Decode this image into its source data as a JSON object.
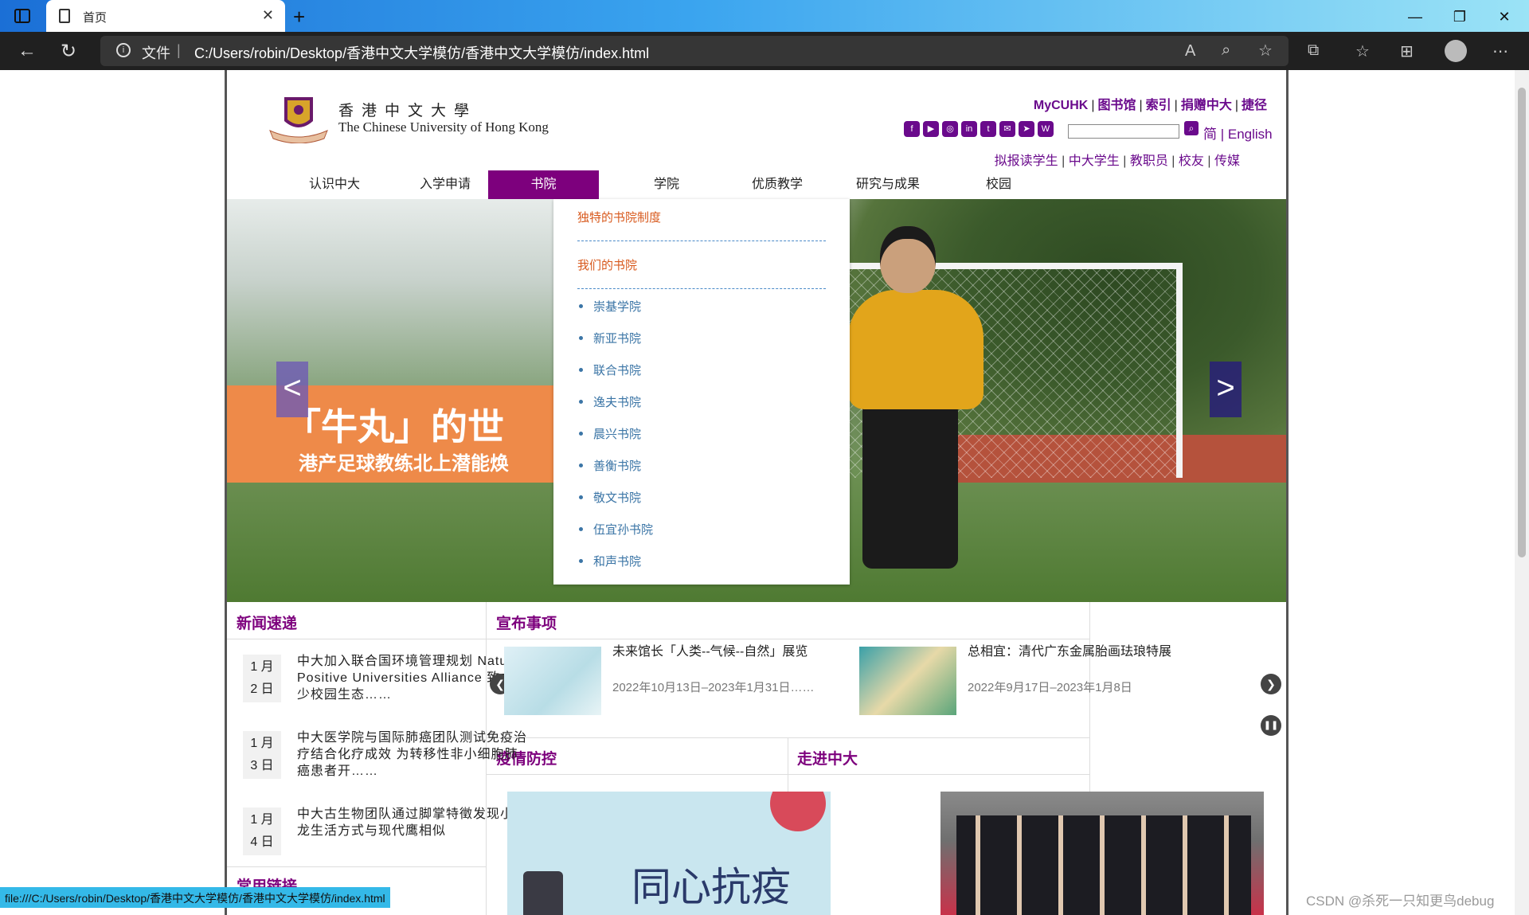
{
  "browser": {
    "tab_title": "首页",
    "url_scheme": "文件",
    "url": "C:/Users/robin/Desktop/香港中文大学模仿/香港中文大学模仿/index.html",
    "status_url": "file:///C:/Users/robin/Desktop/香港中文大学模仿/香港中文大学模仿/index.html"
  },
  "header": {
    "logo_cn": "香港中文大學",
    "logo_en": "The Chinese University of Hong Kong",
    "top_links": [
      "MyCUHK",
      "图书馆",
      "索引",
      "捐赠中大",
      "捷径"
    ],
    "lang_simplified": "简",
    "lang_english": "English",
    "audience_links": [
      "拟报读学生",
      "中大学生",
      "教职员",
      "校友",
      "传媒"
    ]
  },
  "nav": {
    "items": [
      "认识中大",
      "入学申请",
      "书院",
      "学院",
      "优质教学",
      "研究与成果",
      "校园"
    ],
    "active": "书院"
  },
  "dropdown": {
    "heading1": "独特的书院制度",
    "heading2": "我们的书院",
    "colleges": [
      "崇基学院",
      "新亚书院",
      "联合书院",
      "逸夫书院",
      "晨兴书院",
      "善衡书院",
      "敬文书院",
      "伍宜孙书院",
      "和声书院"
    ]
  },
  "hero": {
    "title": "「牛丸」的世",
    "subtitle": "港产足球教练北上潜能焕",
    "prev": "<",
    "next": ">"
  },
  "sections": {
    "news_title": "新闻速递",
    "announce_title": "宣布事项",
    "epidemic_title": "疫情防控",
    "explore_title": "走进中大",
    "links_title": "常用链接"
  },
  "news": [
    {
      "month": "1 月",
      "day": "2 日",
      "text": "中大加入联合国环境管理规划 Nature Positive Universities Alliance 致力减少校园生态……"
    },
    {
      "month": "1 月",
      "day": "3 日",
      "text": "中大医学院与国际肺癌团队测试免疫治疗结合化疗成效 为转移性非小细胞肺癌患者开……"
    },
    {
      "month": "1 月",
      "day": "4 日",
      "text": "中大古生物团队通过脚掌特徵发现小盗龙生活方式与现代鹰相似"
    }
  ],
  "announcements": [
    {
      "title": "未来馆长「人类--气候--自然」展览",
      "date": "2022年10月13日–2023年1月31日……"
    },
    {
      "title": "总相宜：清代广东金属胎画珐琅特展",
      "date": "2022年9月17日–2023年1月8日"
    }
  ],
  "epidemic_banner": "同心抗疫",
  "watermark": "CSDN @杀死一只知更鸟debug",
  "colors": {
    "brand_purple": "#7d007d",
    "orange_banner": "#ee8a49",
    "menu_orange": "#d85a1e",
    "menu_blue": "#3b75a6"
  }
}
